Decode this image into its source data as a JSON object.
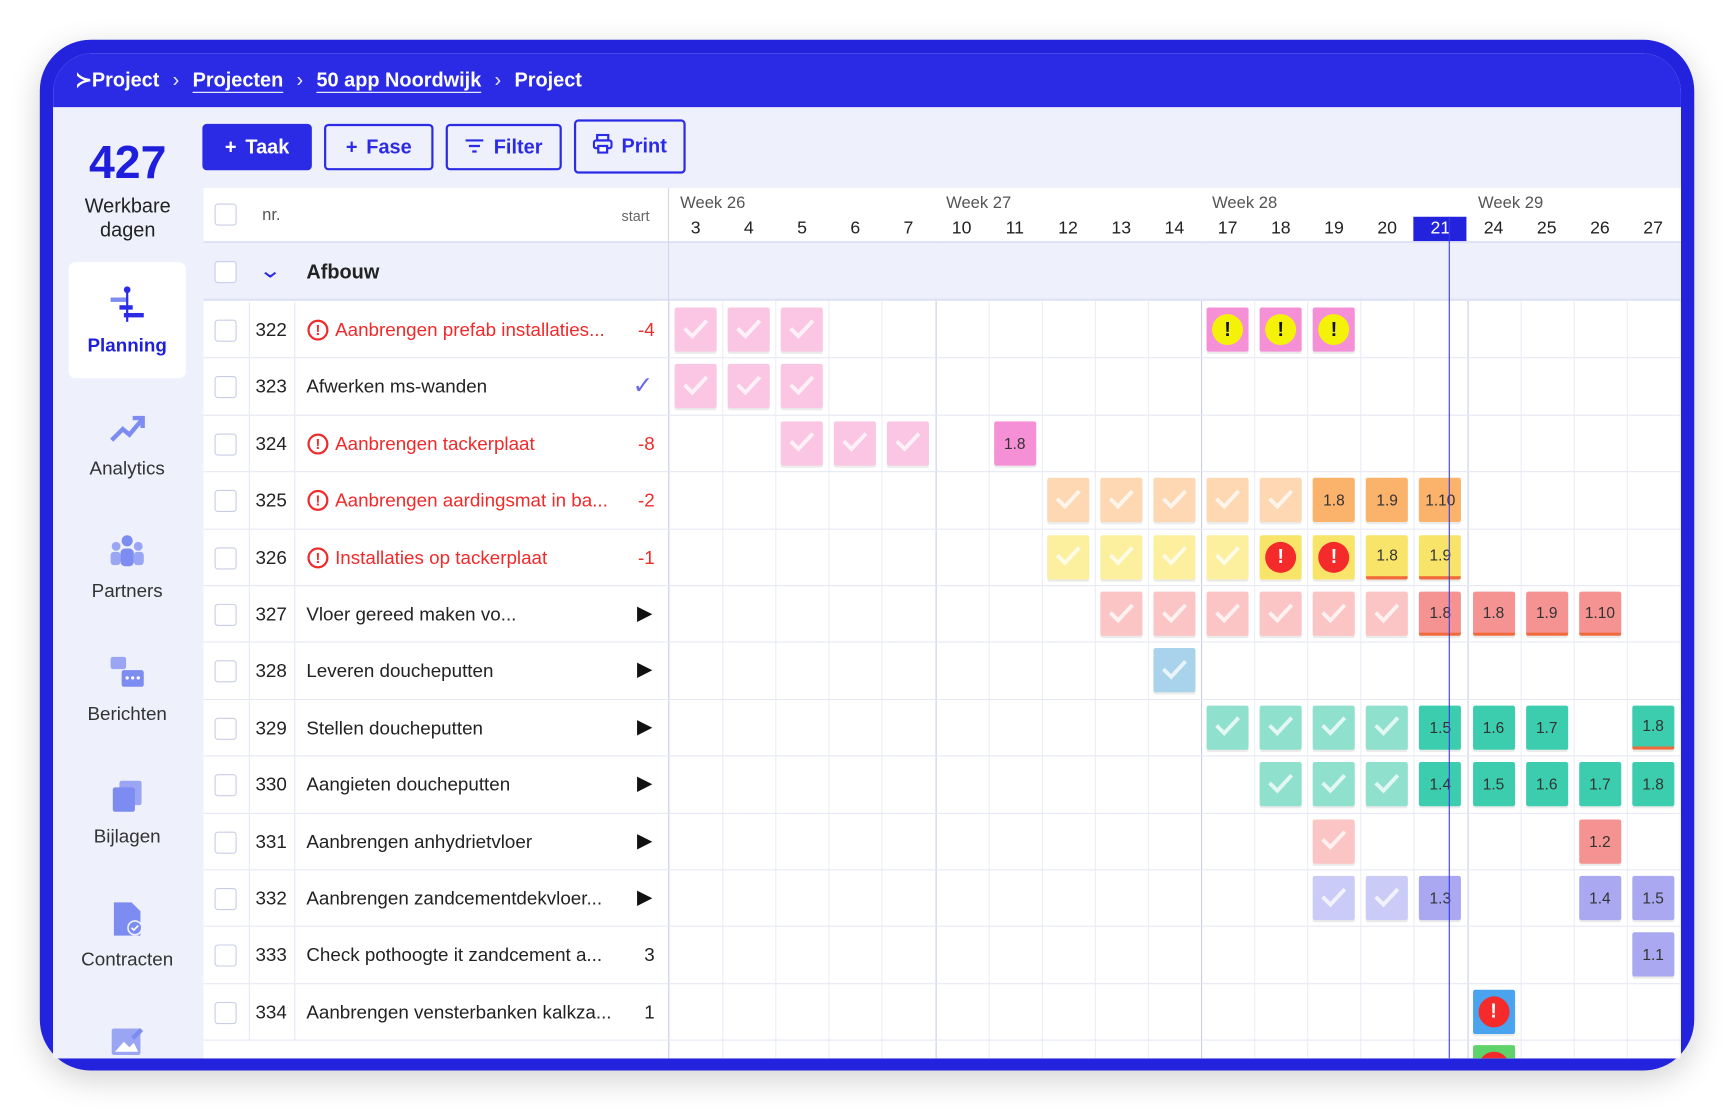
{
  "breadcrumb": {
    "brand": "Project",
    "items": [
      "Projecten",
      "50 app Noordwijk",
      "Project"
    ]
  },
  "sidebar": {
    "count": "427",
    "count_label_1": "Werkbare",
    "count_label_2": "dagen",
    "items": [
      {
        "label": "Planning",
        "icon": "planning-icon",
        "active": true
      },
      {
        "label": "Analytics",
        "icon": "analytics-icon"
      },
      {
        "label": "Partners",
        "icon": "partners-icon"
      },
      {
        "label": "Berichten",
        "icon": "messages-icon"
      },
      {
        "label": "Bijlagen",
        "icon": "attachments-icon"
      },
      {
        "label": "Contracten",
        "icon": "contracts-icon"
      }
    ]
  },
  "toolbar": {
    "taak": "Taak",
    "fase": "Fase",
    "filter": "Filter",
    "print": "Print"
  },
  "table": {
    "col_nr": "nr.",
    "col_start": "start",
    "group": "Afbouw",
    "weeks": [
      "Week 26",
      "Week 27",
      "Week 28",
      "Week 29"
    ],
    "days": [
      "3",
      "4",
      "5",
      "6",
      "7",
      "10",
      "11",
      "12",
      "13",
      "14",
      "17",
      "18",
      "19",
      "20",
      "21",
      "24",
      "25",
      "26",
      "27"
    ],
    "today": "21",
    "rows": [
      {
        "nr": "322",
        "name": "Aanbrengen prefab installaties...",
        "warn": true,
        "start": "-4"
      },
      {
        "nr": "323",
        "name": "Afwerken ms-wanden",
        "status": "check"
      },
      {
        "nr": "324",
        "name": "Aanbrengen tackerplaat",
        "warn": true,
        "start": "-8"
      },
      {
        "nr": "325",
        "name": "Aanbrengen aardingsmat in ba...",
        "warn": true,
        "start": "-2"
      },
      {
        "nr": "326",
        "name": "Installaties op tackerplaat",
        "warn": true,
        "start": "-1"
      },
      {
        "nr": "327",
        "name": "Vloer gereed maken vo...",
        "status": "play"
      },
      {
        "nr": "328",
        "name": "Leveren doucheputten",
        "status": "play"
      },
      {
        "nr": "329",
        "name": "Stellen doucheputten",
        "status": "play"
      },
      {
        "nr": "330",
        "name": "Aangieten doucheputten",
        "status": "play"
      },
      {
        "nr": "331",
        "name": "Aanbrengen anhydrietvloer",
        "status": "play"
      },
      {
        "nr": "332",
        "name": "Aanbrengen zandcementdekvloer...",
        "status": "play"
      },
      {
        "nr": "333",
        "name": "Check pothoogte it zandcement a...",
        "start": "3"
      },
      {
        "nr": "334",
        "name": "Aanbrengen vensterbanken kalkza...",
        "start": "1"
      }
    ]
  },
  "colors": {
    "pink": "#fbc6e4",
    "pinkS": "#f590d6",
    "orange": "#fdd8b2",
    "orangeS": "#fbb26a",
    "yellow": "#fcef9e",
    "yellowS": "#f9e46a",
    "salmon": "#fcc5c5",
    "salmonS": "#f59292",
    "blue": "#a9d3ea",
    "teal": "#8fe0cd",
    "tealS": "#3ccdae",
    "lav": "#cbcbf8",
    "lavS": "#a9a8f1",
    "azure": "#4aa3ef",
    "green": "#5fd36a"
  },
  "gantt": [
    [
      [
        0,
        "pink",
        "c"
      ],
      [
        1,
        "pink",
        "c"
      ],
      [
        2,
        "pink",
        "c"
      ],
      [
        10,
        "pinkS",
        "w"
      ],
      [
        11,
        "pinkS",
        "w"
      ],
      [
        12,
        "pinkS",
        "w"
      ]
    ],
    [
      [
        0,
        "pink",
        "c"
      ],
      [
        1,
        "pink",
        "c"
      ],
      [
        2,
        "pink",
        "c"
      ]
    ],
    [
      [
        2,
        "pink",
        "c"
      ],
      [
        3,
        "pink",
        "c"
      ],
      [
        4,
        "pink",
        "c"
      ],
      [
        6,
        "pinkS",
        "1.8"
      ]
    ],
    [
      [
        7,
        "orange",
        "c"
      ],
      [
        8,
        "orange",
        "c"
      ],
      [
        9,
        "orange",
        "c"
      ],
      [
        10,
        "orange",
        "c"
      ],
      [
        11,
        "orange",
        "c"
      ],
      [
        12,
        "orangeS",
        "1.8"
      ],
      [
        13,
        "orangeS",
        "1.9"
      ],
      [
        14,
        "orangeS",
        "1.10"
      ]
    ],
    [
      [
        7,
        "yellow",
        "c"
      ],
      [
        8,
        "yellow",
        "c"
      ],
      [
        9,
        "yellow",
        "c"
      ],
      [
        10,
        "yellow",
        "c"
      ],
      [
        11,
        "yellowS",
        "e"
      ],
      [
        12,
        "yellowS",
        "e"
      ],
      [
        13,
        "yellowS",
        "1.8",
        "bar"
      ],
      [
        14,
        "yellowS",
        "1.9",
        "bar"
      ]
    ],
    [
      [
        8,
        "salmon",
        "c"
      ],
      [
        9,
        "salmon",
        "c"
      ],
      [
        10,
        "salmon",
        "c"
      ],
      [
        11,
        "salmon",
        "c"
      ],
      [
        12,
        "salmon",
        "c"
      ],
      [
        13,
        "salmon",
        "c"
      ],
      [
        14,
        "salmonS",
        "1.8",
        "bar"
      ],
      [
        15,
        "salmonS",
        "1.8",
        "bar"
      ],
      [
        16,
        "salmonS",
        "1.9",
        "bar"
      ],
      [
        17,
        "salmonS",
        "1.10",
        "bar"
      ]
    ],
    [
      [
        9,
        "blue",
        "c"
      ]
    ],
    [
      [
        10,
        "teal",
        "c"
      ],
      [
        11,
        "teal",
        "c"
      ],
      [
        12,
        "teal",
        "c"
      ],
      [
        13,
        "teal",
        "c"
      ],
      [
        14,
        "tealS",
        "1.5"
      ],
      [
        15,
        "tealS",
        "1.6"
      ],
      [
        16,
        "tealS",
        "1.7"
      ],
      [
        18,
        "tealS",
        "1.8",
        "bar"
      ]
    ],
    [
      [
        11,
        "teal",
        "c"
      ],
      [
        12,
        "teal",
        "c"
      ],
      [
        13,
        "teal",
        "c"
      ],
      [
        14,
        "tealS",
        "1.4"
      ],
      [
        15,
        "tealS",
        "1.5"
      ],
      [
        16,
        "tealS",
        "1.6"
      ],
      [
        17,
        "tealS",
        "1.7"
      ],
      [
        18,
        "tealS",
        "1.8"
      ]
    ],
    [
      [
        12,
        "salmon",
        "c"
      ],
      [
        17,
        "salmonS",
        "1.2"
      ]
    ],
    [
      [
        12,
        "lav",
        "c"
      ],
      [
        13,
        "lav",
        "c"
      ],
      [
        14,
        "lavS",
        "1.3"
      ],
      [
        17,
        "lavS",
        "1.4"
      ],
      [
        18,
        "lavS",
        "1.5"
      ]
    ],
    [
      [
        18,
        "lavS",
        "1.1"
      ]
    ],
    [
      [
        15,
        "azure",
        "e"
      ]
    ],
    [
      [
        15,
        "green",
        "e"
      ]
    ]
  ]
}
